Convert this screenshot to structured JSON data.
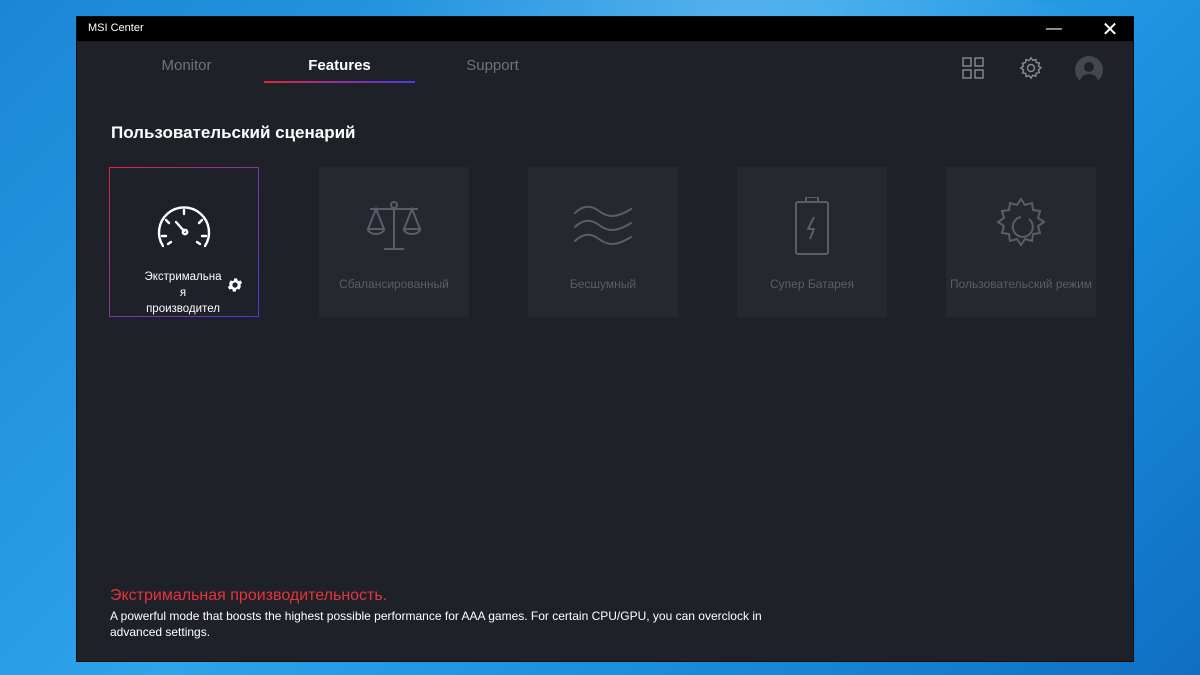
{
  "window": {
    "title": "MSI Center",
    "minimize_glyph": "—",
    "close_glyph": "✕"
  },
  "tabs": [
    {
      "label": "Monitor",
      "active": false
    },
    {
      "label": "Features",
      "active": true
    },
    {
      "label": "Support",
      "active": false
    }
  ],
  "toolbar": {
    "icons": [
      "grid-icon",
      "settings-gear-icon",
      "user-avatar-icon"
    ]
  },
  "section": {
    "title": "Пользовательский сценарий"
  },
  "modes": [
    {
      "label_line1": "Экстримальна",
      "label_line2": "я",
      "label_line3": "производител",
      "icon": "speedometer-icon",
      "active": true
    },
    {
      "label": "Сбалансированный",
      "icon": "balance-scale-icon",
      "active": false
    },
    {
      "label": "Бесшумный",
      "icon": "waves-icon",
      "active": false
    },
    {
      "label": "Супер Батарея",
      "icon": "battery-icon",
      "active": false
    },
    {
      "label": "Пользовательский режим",
      "icon": "custom-gear-icon",
      "active": false
    }
  ],
  "description": {
    "title": "Экстримальная производительность.",
    "text": "A powerful mode that boosts the highest possible performance for AAA games. For certain CPU/GPU, you can overclock in advanced settings."
  },
  "colors": {
    "accent_red": "#e0263f",
    "accent_blue": "#4a3be6",
    "window_bg": "#1f2129",
    "card_bg": "#262830",
    "desc_title": "#e8323c"
  }
}
